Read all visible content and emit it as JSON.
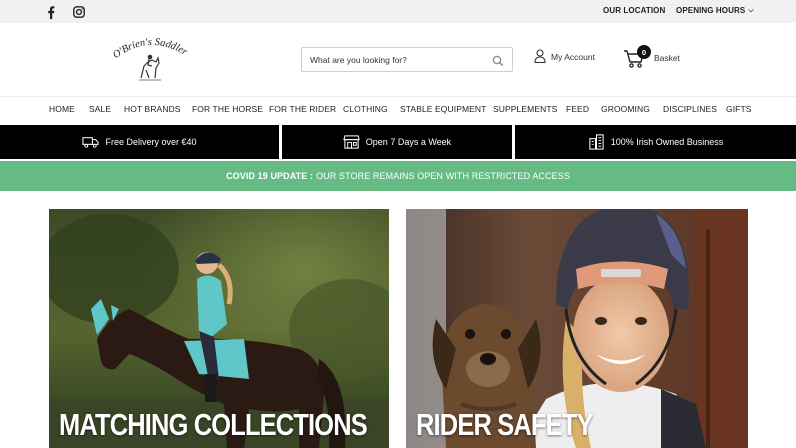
{
  "topbar": {
    "social": [
      {
        "name": "facebook-icon"
      },
      {
        "name": "instagram-icon"
      }
    ],
    "links": {
      "location": "OUR LOCATION",
      "hours": "OPENING HOURS"
    }
  },
  "header": {
    "logo_text": "O'Brien's Saddlery",
    "search_placeholder": "What are you looking for?",
    "account_label": "My Account",
    "basket_label": "Basket",
    "basket_count": "0"
  },
  "nav": {
    "items": [
      "HOME",
      "SALE",
      "HOT BRANDS",
      "FOR THE HORSE",
      "FOR THE RIDER",
      "CLOTHING",
      "STABLE EQUIPMENT",
      "SUPPLEMENTS",
      "FEED",
      "GROOMING",
      "DISCIPLINES",
      "GIFTS"
    ]
  },
  "usps": [
    {
      "icon": "truck-icon",
      "label": "Free Delivery over €40"
    },
    {
      "icon": "store-icon",
      "label": "Open 7 Days a Week"
    },
    {
      "icon": "buildings-icon",
      "label": "100% Irish Owned Business"
    }
  ],
  "notice": {
    "prefix": "COVID 19 UPDATE :",
    "text": "OUR STORE REMAINS OPEN WITH RESTRICTED ACCESS"
  },
  "banners": [
    {
      "title": "MATCHING COLLECTIONS"
    },
    {
      "title": "RIDER SAFETY"
    }
  ],
  "colors": {
    "topbar_bg": "#f1f1f1",
    "usp_bg": "#000000",
    "notice_bg": "#66bb85"
  }
}
